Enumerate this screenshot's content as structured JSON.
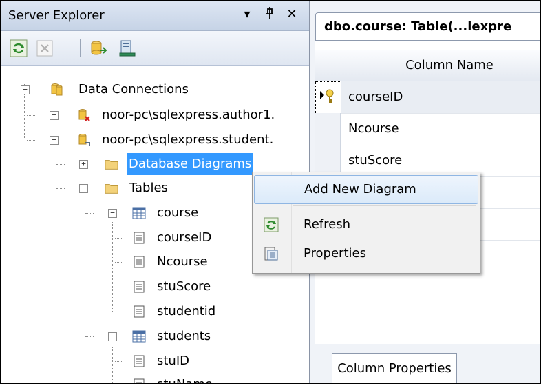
{
  "server_explorer": {
    "title": "Server Explorer",
    "dropdown_glyph": "▾",
    "pin_glyph": "&#x1F588;",
    "close_glyph": "✕",
    "toolbar": [
      "refresh-icon",
      "stop-icon",
      "connect-database-icon",
      "connect-server-icon"
    ]
  },
  "tree": {
    "data_connections": "Data Connections",
    "conn1": "noor-pc\\sqlexpress.author1.",
    "conn2": "noor-pc\\sqlexpress.student.",
    "db_diagrams": "Database Diagrams",
    "tables": "Tables",
    "course": "course",
    "course_cols": [
      "courseID",
      "Ncourse",
      "stuScore",
      "studentid"
    ],
    "students": "students",
    "students_cols": [
      "stuID",
      "stuName"
    ]
  },
  "designer": {
    "tab_title": "dbo.course: Table(...lexpre",
    "column_header": "Column Name",
    "rows": [
      "courseID",
      "Ncourse",
      "stuScore",
      "",
      ""
    ],
    "bottom_tab": "Column Properties"
  },
  "context_menu": {
    "items": [
      "Add New Diagram",
      "Refresh",
      "Properties"
    ]
  }
}
